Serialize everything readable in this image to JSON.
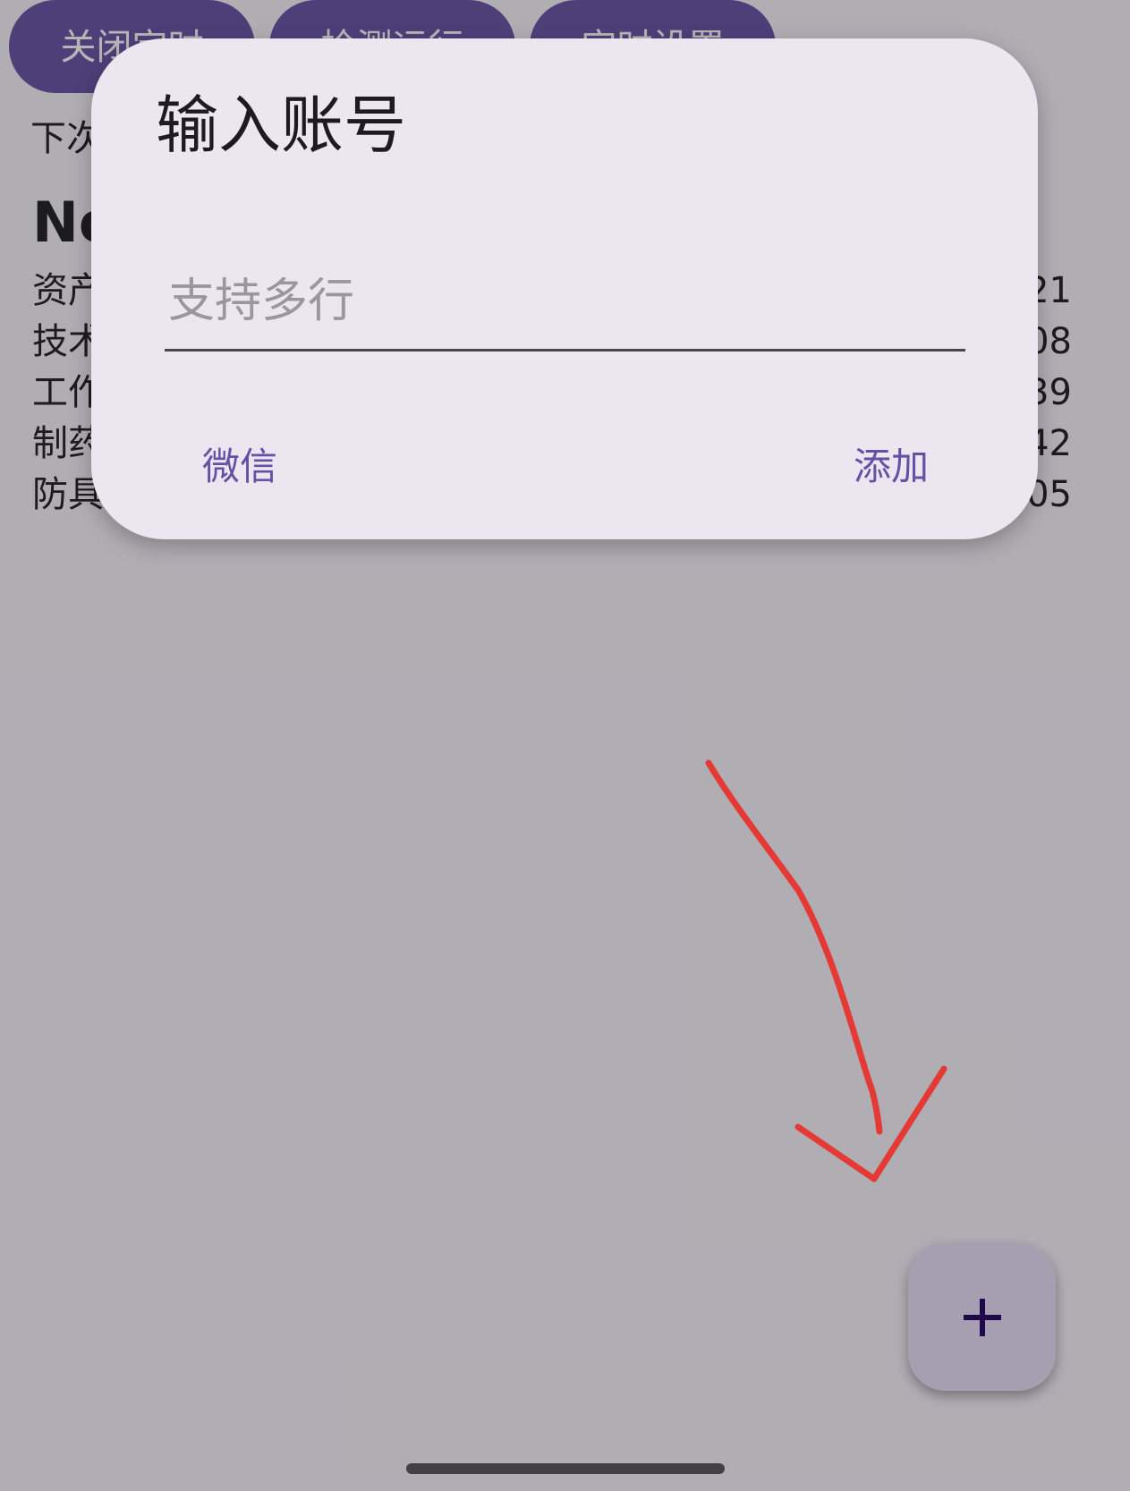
{
  "toolbar": {
    "buttons": [
      {
        "label": "关闭定时"
      },
      {
        "label": "检测运行"
      },
      {
        "label": "定时设置"
      }
    ]
  },
  "schedule": {
    "next_run_label": "下次"
  },
  "account_card": {
    "title": "No",
    "stats": [
      {
        "label": "资产",
        "value": "21"
      },
      {
        "label": "技术",
        "value": "08"
      },
      {
        "label": "工作",
        "value": "39"
      },
      {
        "label": "制药",
        "value": "42"
      },
      {
        "label": "防具",
        "value": "05"
      }
    ]
  },
  "dialog": {
    "title": "输入账号",
    "input_value": "",
    "input_placeholder": "支持多行",
    "wechat_label": "微信",
    "add_label": "添加"
  },
  "fab": {
    "icon": "plus-icon"
  },
  "colors": {
    "primary": "#6750a4",
    "surface": "#f7f2fa",
    "dialog_surface": "#ece6f0",
    "fab_container": "#e8def8",
    "annotation": "#e53935"
  }
}
